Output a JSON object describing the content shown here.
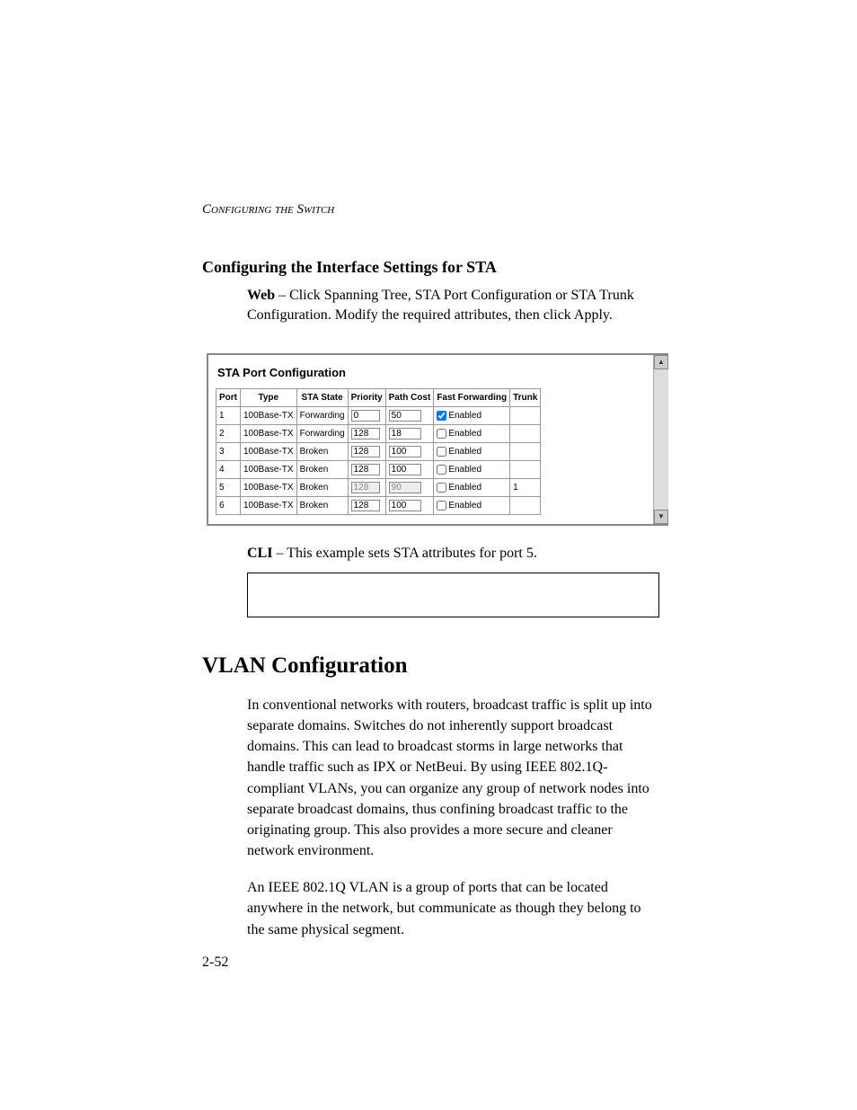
{
  "running_header": "Configuring the Switch",
  "section_heading": "Configuring the Interface Settings for STA",
  "web_label": "Web",
  "web_text": " – Click Spanning Tree, STA Port Configuration or STA Trunk Configuration. Modify the required attributes, then click Apply.",
  "panel": {
    "title": "STA Port Configuration",
    "headers": {
      "port": "Port",
      "type": "Type",
      "sta_state": "STA State",
      "priority": "Priority",
      "path_cost": "Path Cost",
      "fast_forwarding": "Fast Forwarding",
      "trunk": "Trunk"
    },
    "rows": [
      {
        "port": "1",
        "type": "100Base-TX",
        "state": "Forwarding",
        "priority": "0",
        "priority_disabled": false,
        "path_cost": "50",
        "path_cost_disabled": false,
        "ff_checked": true,
        "ff_label": "Enabled",
        "trunk": ""
      },
      {
        "port": "2",
        "type": "100Base-TX",
        "state": "Forwarding",
        "priority": "128",
        "priority_disabled": false,
        "path_cost": "18",
        "path_cost_disabled": false,
        "ff_checked": false,
        "ff_label": "Enabled",
        "trunk": ""
      },
      {
        "port": "3",
        "type": "100Base-TX",
        "state": "Broken",
        "priority": "128",
        "priority_disabled": false,
        "path_cost": "100",
        "path_cost_disabled": false,
        "ff_checked": false,
        "ff_label": "Enabled",
        "trunk": ""
      },
      {
        "port": "4",
        "type": "100Base-TX",
        "state": "Broken",
        "priority": "128",
        "priority_disabled": false,
        "path_cost": "100",
        "path_cost_disabled": false,
        "ff_checked": false,
        "ff_label": "Enabled",
        "trunk": ""
      },
      {
        "port": "5",
        "type": "100Base-TX",
        "state": "Broken",
        "priority": "128",
        "priority_disabled": true,
        "path_cost": "90",
        "path_cost_disabled": true,
        "ff_checked": false,
        "ff_label": "Enabled",
        "trunk": "1"
      },
      {
        "port": "6",
        "type": "100Base-TX",
        "state": "Broken",
        "priority": "128",
        "priority_disabled": false,
        "path_cost": "100",
        "path_cost_disabled": false,
        "ff_checked": false,
        "ff_label": "Enabled",
        "trunk": ""
      }
    ]
  },
  "cli_label": "CLI",
  "cli_text": " – This example sets STA attributes for port 5.",
  "h1": "VLAN Configuration",
  "para1": "In conventional networks with routers, broadcast traffic is split up into separate domains. Switches do not inherently support broadcast domains. This can lead to broadcast storms in large networks that handle traffic such as IPX or NetBeui. By using IEEE 802.1Q-compliant VLANs, you can organize any group of network nodes into separate broadcast domains, thus confining broadcast traffic to the originating group. This also provides a more secure and cleaner network environment.",
  "para2": "An IEEE 802.1Q VLAN is a group of ports that can be located anywhere in the network, but communicate as though they belong to the same physical segment.",
  "page_number": "2-52"
}
